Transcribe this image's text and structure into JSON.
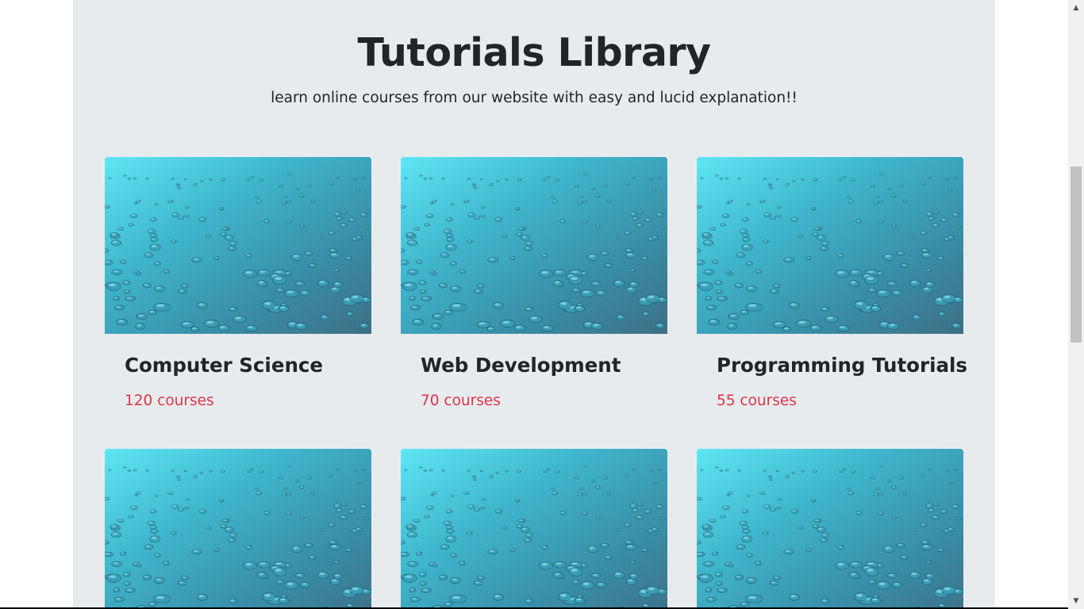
{
  "header": {
    "title": "Tutorials Library",
    "subtitle": "learn online courses from our website with easy and lucid explanation!!"
  },
  "cards": [
    {
      "name": "Computer Science",
      "count": "120 courses",
      "image": "water-droplets-image"
    },
    {
      "name": "Web Development",
      "count": "70 courses",
      "image": "water-droplets-image"
    },
    {
      "name": "Programming Tutorials",
      "count": "55 courses",
      "image": "water-droplets-image"
    },
    {
      "image": "water-droplets-image"
    },
    {
      "image": "water-droplets-image"
    },
    {
      "image": "water-droplets-image"
    }
  ],
  "colors": {
    "background": "#e8ebee",
    "heading": "#212529",
    "count_text": "#dc3545"
  },
  "scrollbar": {
    "up_icon": "triangle-up-icon",
    "down_icon": "triangle-down-icon"
  }
}
